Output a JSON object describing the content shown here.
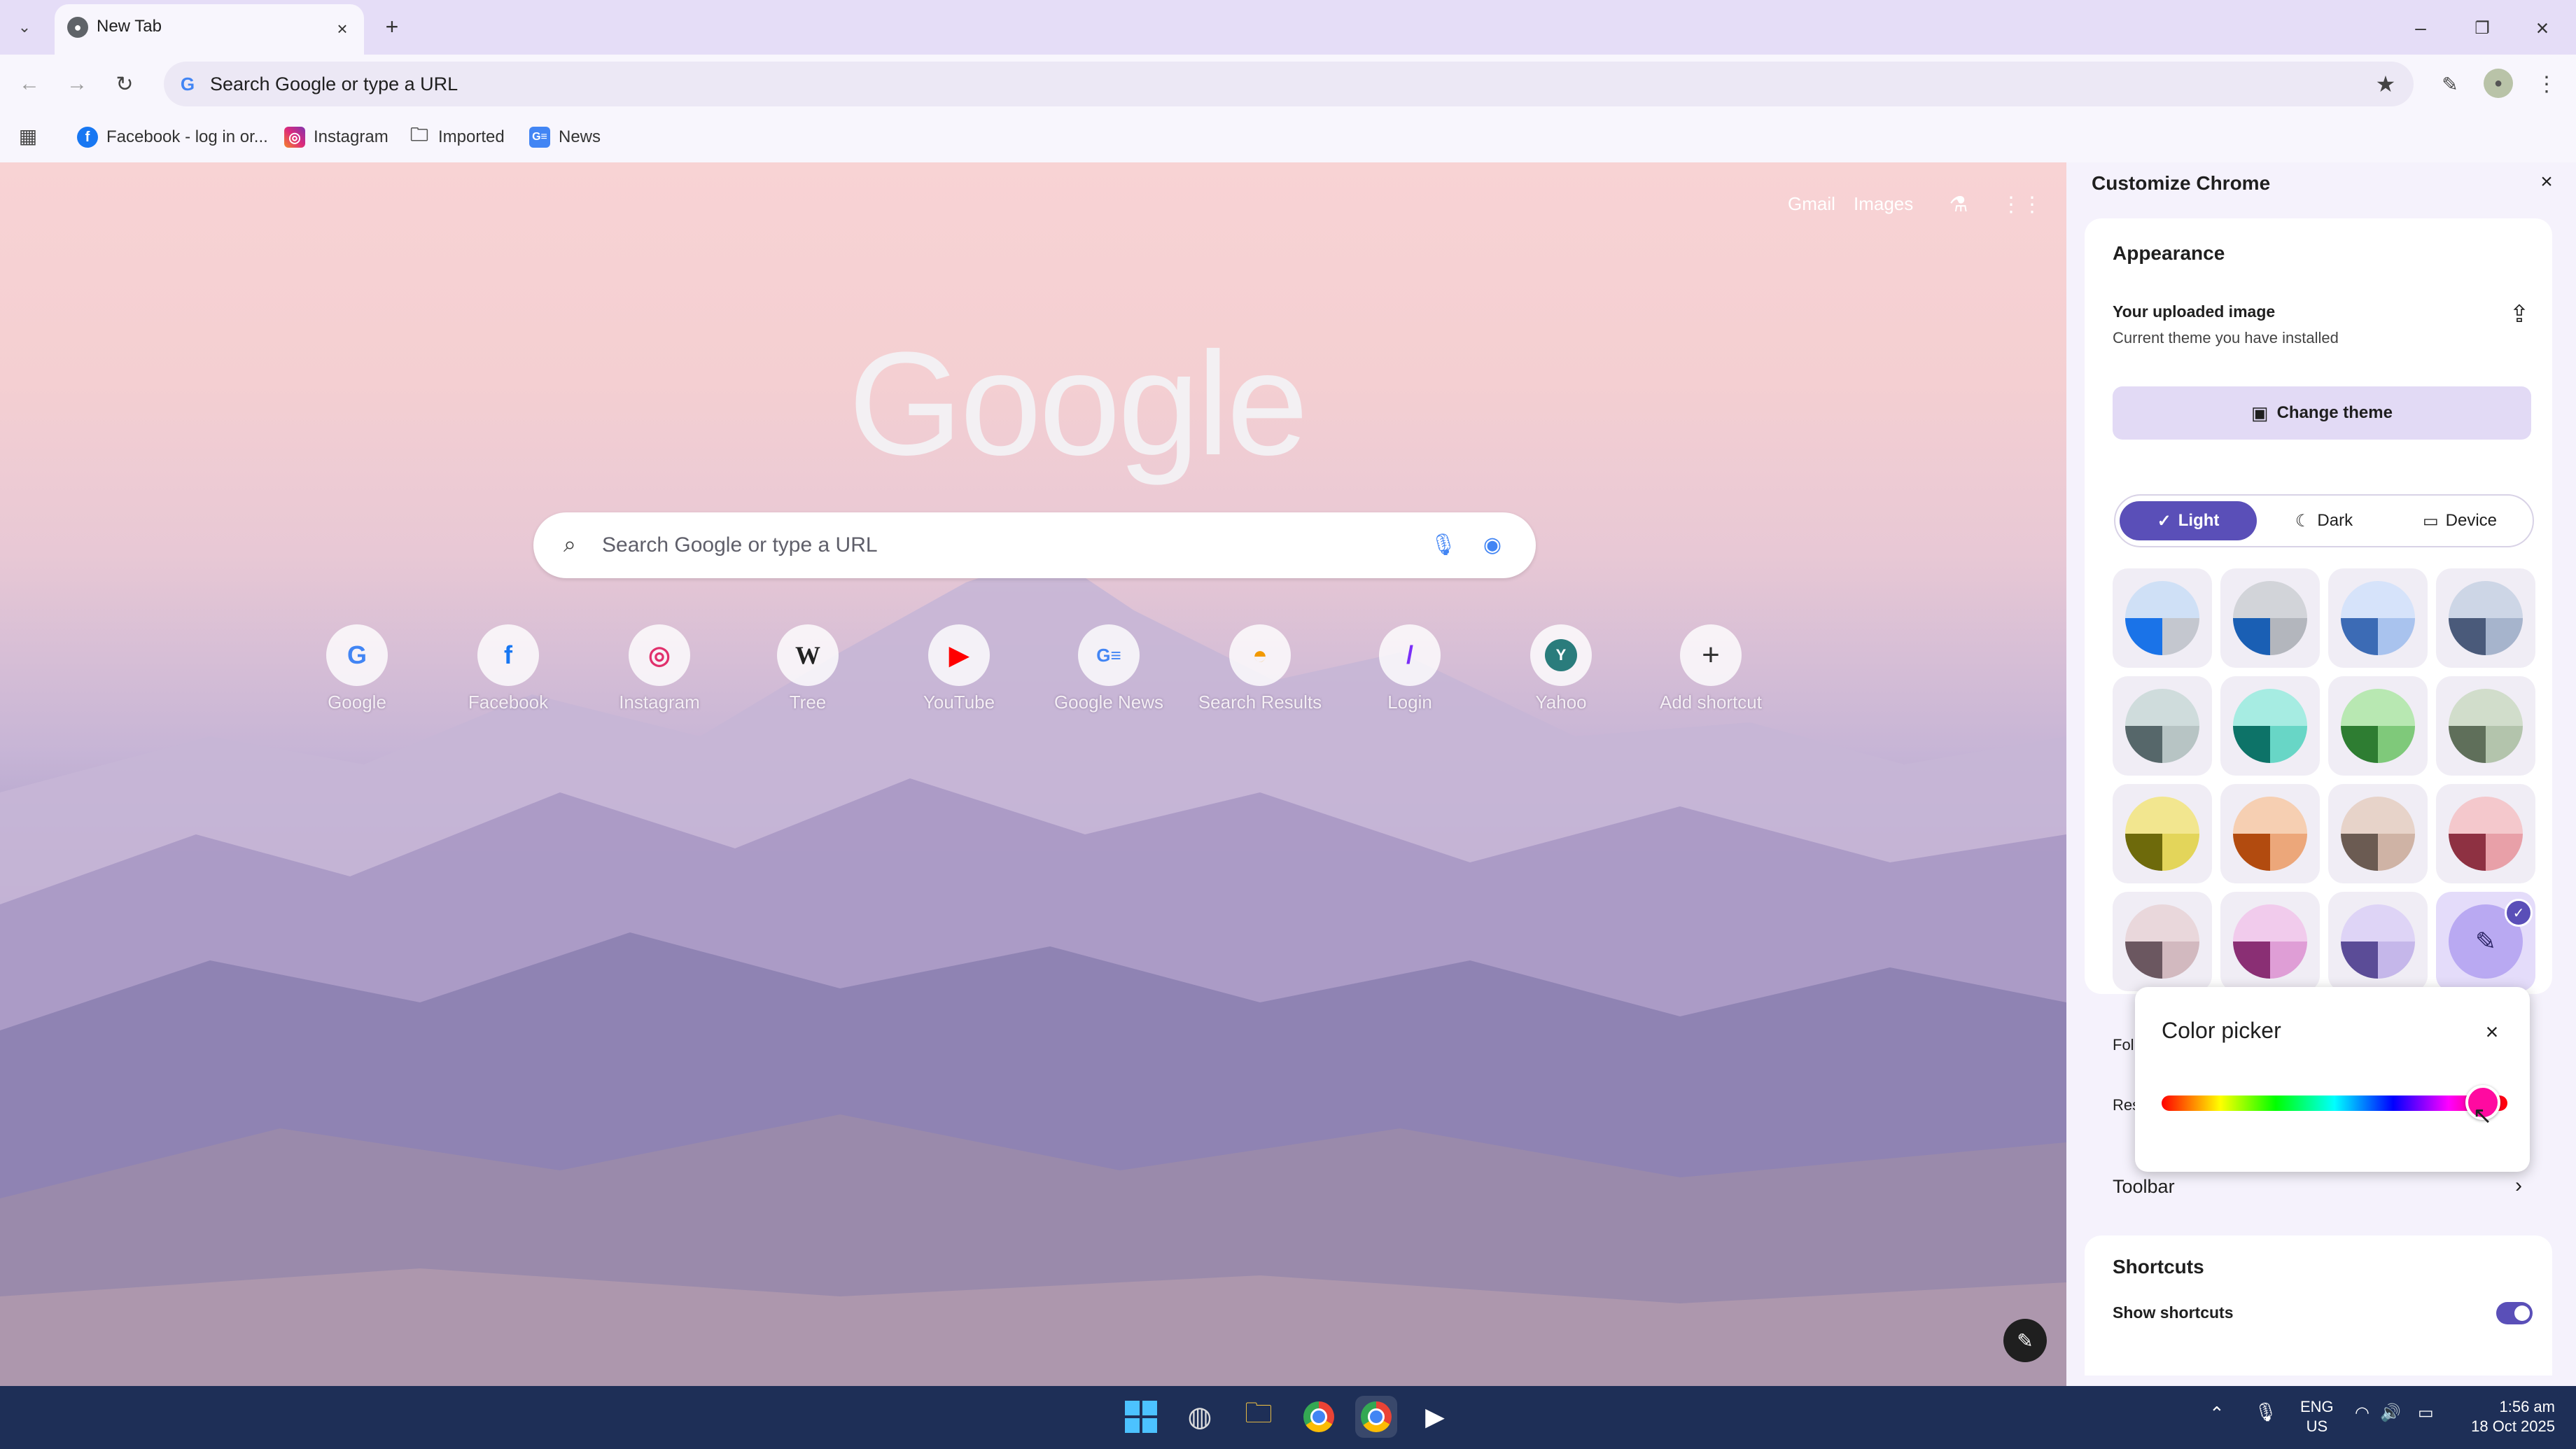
{
  "tab": {
    "title": "New Tab"
  },
  "omnibox": {
    "placeholder": "Search Google or type a URL"
  },
  "bookmarks": [
    {
      "label": "Facebook - log in or...",
      "icon": "facebook-icon"
    },
    {
      "label": "Instagram",
      "icon": "instagram-icon"
    },
    {
      "label": "Imported",
      "icon": "folder-icon"
    },
    {
      "label": "News",
      "icon": "google-news-icon"
    }
  ],
  "ntp": {
    "links": {
      "gmail": "Gmail",
      "images": "Images"
    },
    "logo": "Google",
    "search_placeholder": "Search Google or type a URL",
    "shortcuts": [
      {
        "label": "Google",
        "glyph": "G",
        "color": "#4285f4"
      },
      {
        "label": "Facebook",
        "glyph": "f",
        "color": "#1877f2"
      },
      {
        "label": "Instagram",
        "glyph": "◎",
        "color": "#e1306c"
      },
      {
        "label": "Tree",
        "glyph": "W",
        "color": "#222222"
      },
      {
        "label": "YouTube",
        "glyph": "▶",
        "color": "#ff0000"
      },
      {
        "label": "Google News",
        "glyph": "G≡",
        "color": "#4285f4"
      },
      {
        "label": "Search Results",
        "glyph": "◓",
        "color": "#f29900"
      },
      {
        "label": "Login",
        "glyph": "/",
        "color": "#7b2ff7"
      },
      {
        "label": "Yahoo",
        "glyph": "Y",
        "color": "#2a7c7c"
      },
      {
        "label": "Add shortcut",
        "glyph": "+",
        "color": "#333333"
      }
    ]
  },
  "panel": {
    "title": "Customize Chrome",
    "appearance": {
      "heading": "Appearance",
      "theme_title": "Your uploaded image",
      "theme_subtitle": "Current theme you have installed",
      "change_theme": "Change theme",
      "modes": {
        "light": "Light",
        "dark": "Dark",
        "device": "Device"
      },
      "selected_mode": "Light"
    },
    "partial_labels": {
      "follow": "Fol",
      "reset": "Res"
    },
    "toolbar_label": "Toolbar",
    "shortcuts": {
      "heading": "Shortcuts",
      "show_label": "Show shortcuts",
      "enabled": true
    }
  },
  "color_picker": {
    "title": "Color picker",
    "hue_position": 0.93,
    "selected_color": "#ff0aa0"
  },
  "swatches": [
    [
      "#1a73e8",
      "#c4c7cf",
      "#cfe0f6"
    ],
    [
      "#1a5fb4",
      "#b3b6bd",
      "#d2d4d9"
    ],
    [
      "#3c6bb5",
      "#a9c3ee",
      "#d6e3fa"
    ],
    [
      "#4a5a7a",
      "#a6b4cc",
      "#cdd6e6"
    ],
    [
      "#56676a",
      "#b7c4c4",
      "#cfdcdc"
    ],
    [
      "#0d7368",
      "#68d6c6",
      "#a6ece2"
    ],
    [
      "#2e7d32",
      "#7fc97a",
      "#b8e8b2"
    ],
    [
      "#5f6f5a",
      "#b3c4ac",
      "#d1ddcb"
    ],
    [
      "#6e6a0b",
      "#e3d55a",
      "#f2e68f"
    ],
    [
      "#b24b0f",
      "#eca77a",
      "#f6cfb2"
    ],
    [
      "#6b5b52",
      "#cfb3a5",
      "#e7d3c9"
    ],
    [
      "#8e3142",
      "#e8a0a8",
      "#f4c8cc"
    ],
    [
      "#6b5760",
      "#d2b9bf",
      "#e9d7db"
    ],
    [
      "#8a2f74",
      "#df9ed6",
      "#f1cbec"
    ],
    [
      "#5b4c97",
      "#c5b7ea",
      "#ded4f6"
    ],
    [
      "#6a58c9",
      "#b9a9f2",
      "#d8cdfb"
    ]
  ],
  "taskbar": {
    "lang": "ENG",
    "region": "US",
    "time": "1:56 am",
    "date": "18 Oct 2025"
  },
  "colors": {
    "accent": "#5a4fb8",
    "panel_bg": "#f5f2fc",
    "taskbar": "#1e2f57"
  }
}
